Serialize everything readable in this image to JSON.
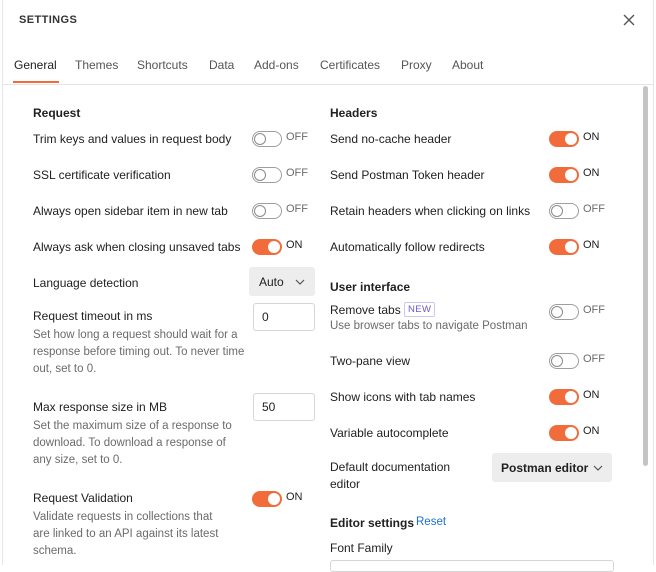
{
  "title": "SETTINGS",
  "tabs": [
    "General",
    "Themes",
    "Shortcuts",
    "Data",
    "Add-ons",
    "Certificates",
    "Proxy",
    "About"
  ],
  "request": {
    "header": "Request",
    "trim": {
      "label": "Trim keys and values in request body",
      "state": "OFF"
    },
    "ssl": {
      "label": "SSL certificate verification",
      "state": "OFF"
    },
    "sidebar": {
      "label": "Always open sidebar item in new tab",
      "state": "OFF"
    },
    "ask_close": {
      "label": "Always ask when closing unsaved tabs",
      "state": "ON"
    },
    "lang": {
      "label": "Language detection",
      "value": "Auto"
    },
    "timeout": {
      "label": "Request timeout in ms",
      "desc": "Set how long a request should wait for a response before timing out. To never time out, set to 0.",
      "value": "0"
    },
    "maxsize": {
      "label": "Max response size in MB",
      "desc": "Set the maximum size of a response to download. To download a response of any size, set to 0.",
      "value": "50"
    },
    "validation": {
      "label": "Request Validation",
      "desc": "Validate requests in collections that are linked to an API against its latest schema.",
      "state": "ON"
    }
  },
  "headers": {
    "header": "Headers",
    "nocache": {
      "label": "Send no-cache header",
      "state": "ON"
    },
    "token": {
      "label": "Send Postman Token header",
      "state": "ON"
    },
    "retain": {
      "label": "Retain headers when clicking on links",
      "state": "OFF"
    },
    "redirects": {
      "label": "Automatically follow redirects",
      "state": "ON"
    }
  },
  "ui": {
    "header": "User interface",
    "remove_tabs": {
      "label": "Remove tabs",
      "badge": "NEW",
      "desc": "Use browser tabs to navigate Postman",
      "state": "OFF"
    },
    "twopane": {
      "label": "Two-pane view",
      "state": "OFF"
    },
    "icons": {
      "label": "Show icons with tab names",
      "state": "ON"
    },
    "autocomplete": {
      "label": "Variable autocomplete",
      "state": "ON"
    },
    "docs_editor": {
      "label_line1": "Default documentation",
      "label_line2": "editor",
      "value": "Postman editor"
    }
  },
  "editor": {
    "header": "Editor settings",
    "reset": "Reset",
    "font_family": "Font Family"
  },
  "colors": {
    "accent": "#f26b3a",
    "link": "#1c6ed1",
    "badge": "#6b5bd6"
  }
}
